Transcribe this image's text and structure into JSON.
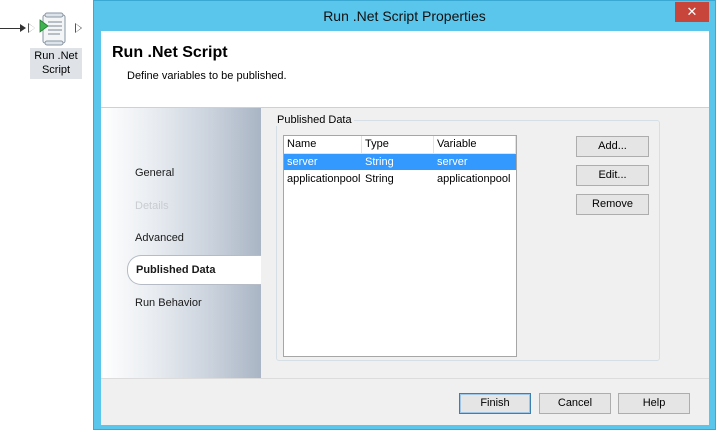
{
  "canvas": {
    "activity": {
      "label_line1": "Run .Net",
      "label_line2": "Script",
      "icon": "script-scroll-icon"
    }
  },
  "dialog": {
    "title": "Run .Net Script Properties",
    "close_glyph": "✕",
    "header": {
      "title": "Run .Net Script",
      "subtitle": "Define variables to be published."
    },
    "nav": {
      "general": "General",
      "details": "Details",
      "advanced": "Advanced",
      "published_data": "Published Data",
      "run_behavior": "Run Behavior"
    },
    "published_data": {
      "group_label": "Published Data",
      "columns": {
        "name": "Name",
        "type": "Type",
        "variable": "Variable"
      },
      "rows": [
        {
          "name": "server",
          "type": "String",
          "variable": "server",
          "selected": true
        },
        {
          "name": "applicationpool",
          "type": "String",
          "variable": "applicationpool",
          "selected": false
        }
      ],
      "buttons": {
        "add": "Add...",
        "edit": "Edit...",
        "remove": "Remove"
      }
    },
    "footer": {
      "finish": "Finish",
      "cancel": "Cancel",
      "help": "Help"
    },
    "colors": {
      "frame": "#5bc6ec",
      "close": "#c7453a",
      "selection": "#3399ff"
    }
  }
}
